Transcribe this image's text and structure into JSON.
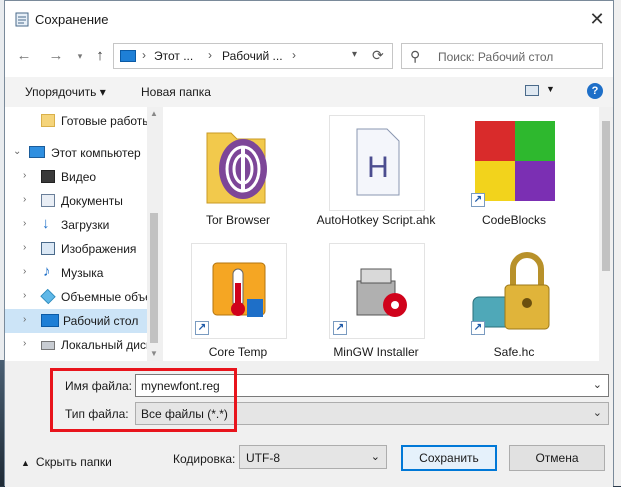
{
  "window": {
    "title": "Сохранение"
  },
  "address": {
    "crumbs": [
      "Этот ...",
      "Рабочий ..."
    ]
  },
  "search": {
    "placeholder": "Поиск: Рабочий стол"
  },
  "toolbar": {
    "organize": "Упорядочить ▾",
    "new_folder": "Новая папка",
    "help": "?"
  },
  "nav": {
    "items": [
      {
        "label": "Готовые работы",
        "icon": "folder-icon"
      },
      {
        "label": "Этот компьютер",
        "icon": "computer-icon"
      },
      {
        "label": "Видео",
        "icon": "video-icon"
      },
      {
        "label": "Документы",
        "icon": "documents-icon"
      },
      {
        "label": "Загрузки",
        "icon": "downloads-icon"
      },
      {
        "label": "Изображения",
        "icon": "pictures-icon"
      },
      {
        "label": "Музыка",
        "icon": "music-icon"
      },
      {
        "label": "Объемные объекты",
        "icon": "3d-objects-icon"
      },
      {
        "label": "Рабочий стол",
        "icon": "desktop-icon",
        "selected": true
      },
      {
        "label": "Локальный диск",
        "icon": "disk-icon"
      }
    ]
  },
  "files": [
    {
      "name": "Tor Browser",
      "icon": "tor-browser-icon",
      "shortcut": false
    },
    {
      "name": "AutoHotkey Script.ahk",
      "icon": "ahk-script-icon",
      "shortcut": false
    },
    {
      "name": "CodeBlocks",
      "icon": "codeblocks-icon",
      "shortcut": true
    },
    {
      "name": "Core Temp",
      "icon": "core-temp-icon",
      "shortcut": true
    },
    {
      "name": "MinGW Installer",
      "icon": "mingw-installer-icon",
      "shortcut": true
    },
    {
      "name": "Safe.hc",
      "icon": "safe-hc-icon",
      "shortcut": true
    }
  ],
  "form": {
    "filename_label": "Имя файла:",
    "filename_value": "mynewfont.reg",
    "filetype_label": "Тип файла:",
    "filetype_value": "Все файлы  (*.*)",
    "encoding_label": "Кодировка:",
    "encoding_value": "UTF-8",
    "hide_folders": "Скрыть папки"
  },
  "buttons": {
    "save": "Сохранить",
    "cancel": "Отмена"
  },
  "colors": {
    "highlight": "#e8141c",
    "accent": "#0078d7",
    "selection": "#cce4f7"
  }
}
